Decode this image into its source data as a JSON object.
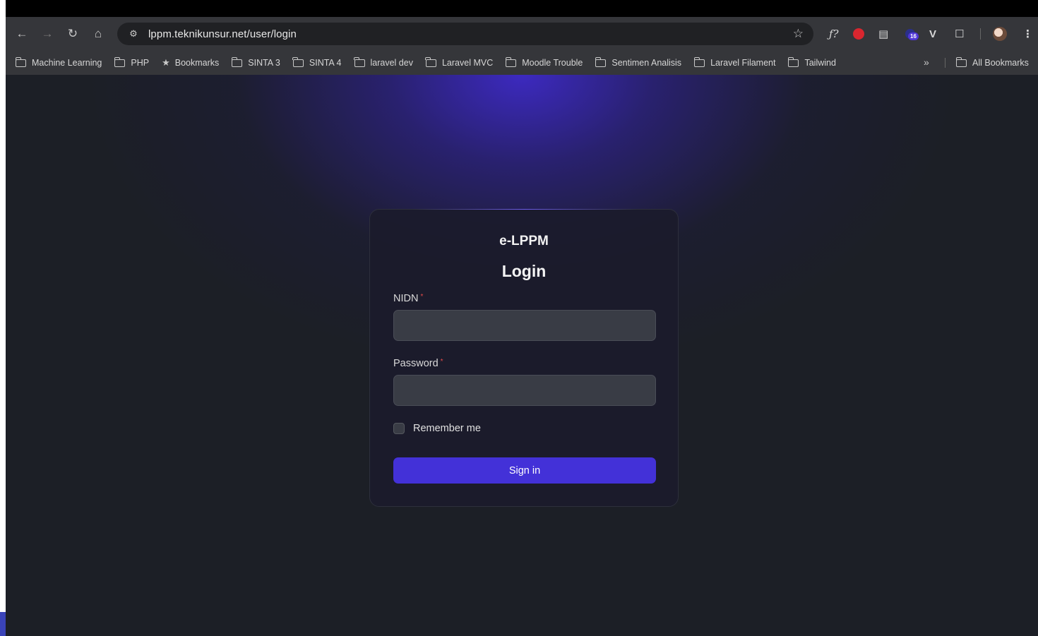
{
  "browser": {
    "url": "lppm.teknikunsur.net/user/login",
    "extension_badge": "16",
    "extensions": [
      "fx-icon",
      "adblock-icon",
      "reader-icon",
      "extension-badge-icon",
      "vue-devtools-icon",
      "puzzle-icon"
    ],
    "bookmarks": [
      {
        "label": "Machine Learning",
        "icon": "folder-icon"
      },
      {
        "label": "PHP",
        "icon": "folder-icon"
      },
      {
        "label": "Bookmarks",
        "icon": "star-icon"
      },
      {
        "label": "SINTA 3",
        "icon": "folder-icon"
      },
      {
        "label": "SINTA 4",
        "icon": "folder-icon"
      },
      {
        "label": "laravel dev",
        "icon": "folder-icon"
      },
      {
        "label": "Laravel MVC",
        "icon": "folder-icon"
      },
      {
        "label": "Moodle Trouble",
        "icon": "folder-icon"
      },
      {
        "label": "Sentimen Analisis",
        "icon": "folder-icon"
      },
      {
        "label": "Laravel Filament",
        "icon": "folder-icon"
      },
      {
        "label": "Tailwind",
        "icon": "folder-icon"
      }
    ],
    "bookmarks_overflow": "»",
    "all_bookmarks": "All Bookmarks"
  },
  "login": {
    "brand": "e-LPPM",
    "heading": "Login",
    "nidn_label": "NIDN",
    "nidn_value": "",
    "password_label": "Password",
    "password_value": "",
    "required_marker": "*",
    "remember_label": "Remember me",
    "remember_checked": false,
    "submit_label": "Sign in"
  },
  "colors": {
    "accent": "#4331d8",
    "page_bg": "#1c1f26",
    "card_bg": "#1b1b2b",
    "required": "#e24a4a"
  }
}
